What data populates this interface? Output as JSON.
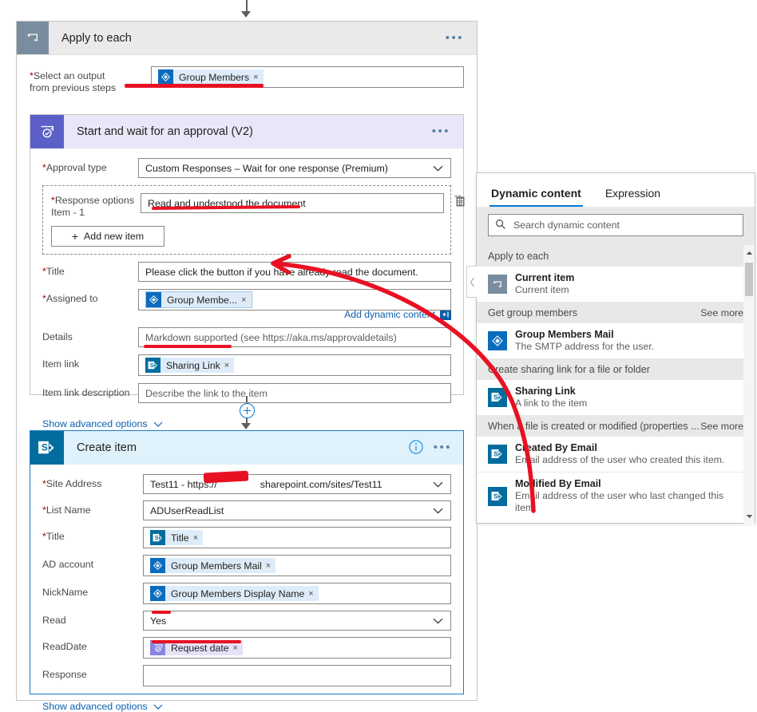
{
  "scope": {
    "title": "Apply to each",
    "icon": "loop-icon",
    "more": "•••",
    "output_field": {
      "label_required": "*",
      "label_line1": "Select an output",
      "label_line2": "from previous steps",
      "token": {
        "text": "Group Members",
        "icon": "azure-ad-icon",
        "remove": "×"
      }
    }
  },
  "approval": {
    "title": "Start and wait for an approval (V2)",
    "icon": "approval-icon",
    "more": "•••",
    "fields": {
      "approval_type": {
        "label": "Approval type",
        "required": true,
        "value": "Custom Responses – Wait for one response (Premium)"
      },
      "response_options": {
        "label_line1": "Response options",
        "label_line2": "Item - 1",
        "required": true,
        "value": "Read and understood the document",
        "add_new": "Add new item",
        "switch_icon": "switch-to-array-icon"
      },
      "title_field": {
        "label": "Title",
        "required": true,
        "value": "Please click the button if you have already read the document."
      },
      "assigned_to": {
        "label": "Assigned to",
        "required": true,
        "token": {
          "text": "Group Membe...",
          "icon": "azure-ad-icon",
          "remove": "×"
        }
      },
      "add_dynamic_content": {
        "label": "Add dynamic content",
        "badge_icon": "fx-plus-icon"
      },
      "details": {
        "label": "Details",
        "required": false,
        "placeholder": "Markdown supported (see https://aka.ms/approvaldetails)"
      },
      "item_link": {
        "label": "Item link",
        "required": false,
        "token": {
          "text": "Sharing Link",
          "icon": "sharepoint-icon",
          "remove": "×"
        }
      },
      "item_link_description": {
        "label": "Item link description",
        "required": false,
        "placeholder": "Describe the link to the item"
      }
    },
    "show_advanced": "Show advanced options"
  },
  "create_item": {
    "title": "Create item",
    "icon": "sharepoint-icon",
    "info_icon": "info-icon",
    "more": "•••",
    "fields": [
      {
        "label": "Site Address",
        "required": true,
        "type": "dropdown",
        "value": "Test11 - https://████sharepoint.com/sites/Test11"
      },
      {
        "label": "List Name",
        "required": true,
        "type": "dropdown",
        "value": "ADUserReadList"
      },
      {
        "label": "Title",
        "required": true,
        "type": "token",
        "token": {
          "text": "Title",
          "icon": "sharepoint-icon",
          "remove": "×"
        }
      },
      {
        "label": "AD account",
        "required": false,
        "type": "token",
        "token": {
          "text": "Group Members Mail",
          "icon": "azure-ad-icon",
          "remove": "×"
        }
      },
      {
        "label": "NickName",
        "required": false,
        "type": "token",
        "token": {
          "text": "Group Members Display Name",
          "icon": "azure-ad-icon",
          "remove": "×"
        }
      },
      {
        "label": "Read",
        "required": false,
        "type": "dropdown",
        "value": "Yes"
      },
      {
        "label": "ReadDate",
        "required": false,
        "type": "token",
        "token": {
          "text": "Request date",
          "icon": "approval-icon",
          "remove": "×"
        }
      },
      {
        "label": "Response",
        "required": false,
        "type": "text",
        "value": ""
      }
    ],
    "show_advanced": "Show advanced options"
  },
  "dynamic_panel": {
    "tabs": [
      {
        "label": "Dynamic content",
        "active": true
      },
      {
        "label": "Expression",
        "active": false
      }
    ],
    "search_placeholder": "Search dynamic content",
    "search_icon": "search-icon",
    "groups": [
      {
        "name": "Apply to each",
        "see_more": "",
        "items": [
          {
            "name": "Current item",
            "desc": "Current item",
            "icon": "loop-icon"
          }
        ]
      },
      {
        "name": "Get group members",
        "see_more": "See more",
        "items": [
          {
            "name": "Group Members Mail",
            "desc": "The SMTP address for the user.",
            "icon": "azure-ad-icon"
          }
        ]
      },
      {
        "name": "Create sharing link for a file or folder",
        "see_more": "",
        "items": [
          {
            "name": "Sharing Link",
            "desc": "A link to the item",
            "icon": "sharepoint-icon"
          }
        ]
      },
      {
        "name": "When a file is created or modified (properties ...",
        "see_more": "See more",
        "items": [
          {
            "name": "Created By Email",
            "desc": "Email address of the user who created this item.",
            "icon": "sharepoint-icon"
          },
          {
            "name": "Modified By Email",
            "desc": "Email address of the user who last changed this item.",
            "icon": "sharepoint-icon"
          }
        ]
      }
    ],
    "scroll_up_icon": "scroll-up-icon",
    "scroll_down_icon": "scroll-down-icon",
    "collapse_icon": "chevron-left-icon"
  },
  "colors": {
    "annotation": "#e81123",
    "accent": "#0078d4",
    "sharepoint": "#036c9e",
    "approval": "#5b5fc7",
    "azure_ad": "#0b6bbd"
  }
}
